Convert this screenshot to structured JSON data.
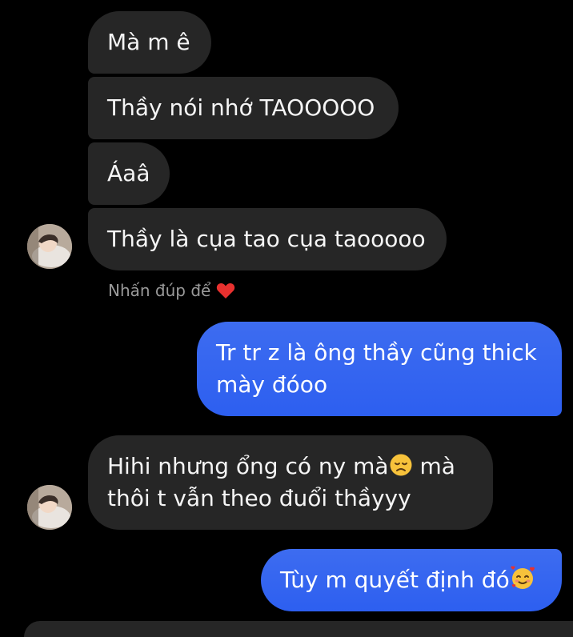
{
  "messages": [
    {
      "text": "Mà m ê"
    },
    {
      "text": "Thầy nói nhớ TAOOOOO"
    },
    {
      "text": "Áaâ"
    },
    {
      "text": "Thầy là cụa tao cụa taooooo"
    },
    {
      "lines": [
        "Tr tr z là ông thầy cũng thick",
        "mày đóoo"
      ]
    },
    {
      "lines": [
        "Hihi nhưng ổng có ny mà",
        "thôi t vẫn theo đuổi thầyyy"
      ]
    },
    {
      "text": "Tùy m quyết định đó"
    }
  ],
  "hint": {
    "text": "Nhấn đúp để"
  },
  "colors": {
    "background": "#000000",
    "incoming": "#262626",
    "outgoing": "#2d5ff0",
    "heart": "#e8312f"
  },
  "icons": [
    "heart-icon",
    "sad-face-icon",
    "smiling-face-with-hearts-icon",
    "avatar"
  ]
}
